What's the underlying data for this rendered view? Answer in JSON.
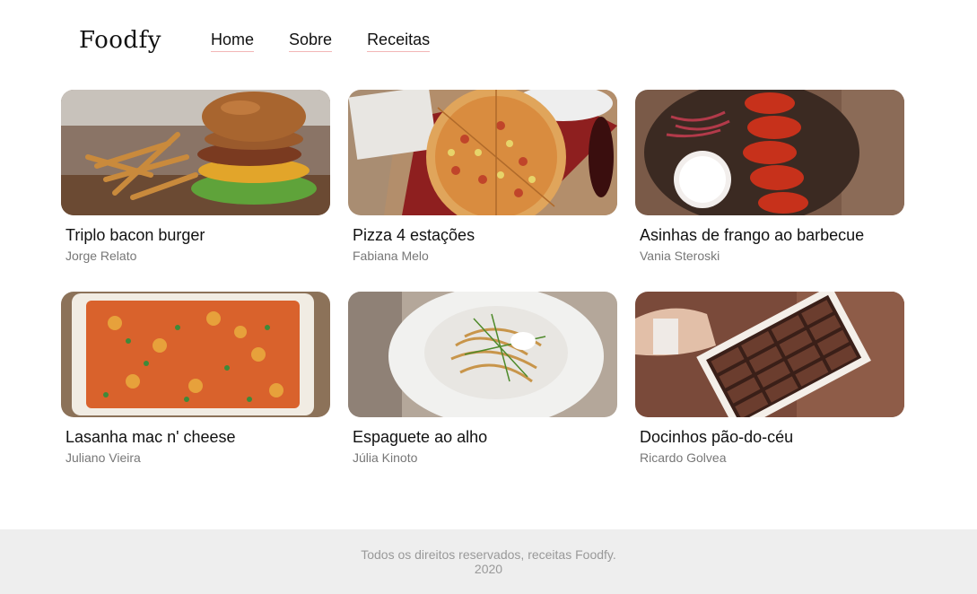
{
  "header": {
    "logo": "Foodfy",
    "nav": [
      "Home",
      "Sobre",
      "Receitas"
    ]
  },
  "recipes": [
    {
      "title": "Triplo bacon burger",
      "author": "Jorge Relato",
      "image_icon": "burger-photo"
    },
    {
      "title": "Pizza 4 estações",
      "author": "Fabiana Melo",
      "image_icon": "pizza-photo"
    },
    {
      "title": "Asinhas de frango ao barbecue",
      "author": "Vania Steroski",
      "image_icon": "chicken-wings-photo"
    },
    {
      "title": "Lasanha mac n' cheese",
      "author": "Juliano Vieira",
      "image_icon": "lasagna-photo"
    },
    {
      "title": "Espaguete ao alho",
      "author": "Júlia Kinoto",
      "image_icon": "spaghetti-photo"
    },
    {
      "title": "Docinhos pão-do-céu",
      "author": "Ricardo Golvea",
      "image_icon": "chocolates-photo"
    }
  ],
  "footer": {
    "line1": "Todos os direitos reservados, receitas Foodfy.",
    "line2": "2020"
  },
  "colors": {
    "nav_underline": "#f2b6b6",
    "author_text": "#777777",
    "footer_bg": "#eeeeee",
    "footer_text": "#999999"
  }
}
